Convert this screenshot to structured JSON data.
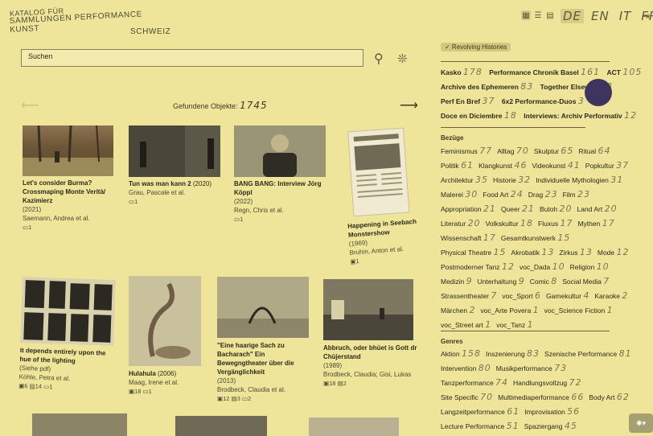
{
  "logo": {
    "line1": "KATALOG FÜR",
    "line2": "SAMMLUNGEN PERFORMANCE KUNST",
    "line3": "SCHWEIZ"
  },
  "view_icons": [
    "grid-view-icon",
    "list-view-icon",
    "table-view-icon"
  ],
  "languages": [
    {
      "label": "DE",
      "active": true
    },
    {
      "label": "EN"
    },
    {
      "label": "IT"
    },
    {
      "label": "FR"
    }
  ],
  "search": {
    "placeholder": "Suchen"
  },
  "results": {
    "label": "Gefundene Objekte:",
    "count": "1745"
  },
  "cards": [
    {
      "title": "Let's consider Burma? Crossmaping Monte Verità/ Kazimierz",
      "year": "(2021)",
      "author": "Saemann, Andrea et al.",
      "counts": "▭1"
    },
    {
      "title": "Tun was man kann 2",
      "year": "(2020)",
      "author": "Grau, Pascale et al.",
      "counts": "▭1"
    },
    {
      "title": "BANG BANG: Interview Jörg Köppl",
      "year": "(2022)",
      "author": "Regn, Chris et al.",
      "counts": "▭1"
    },
    {
      "title": "Happening in Seebach Monstershow",
      "year": "(1969)",
      "author": "Bruhin, Anton et al.",
      "counts": "▣1"
    },
    {
      "title": "It depends entirely upon the hue of the lighting",
      "year": "(Siehe pdf)",
      "author": "Köhle, Petra et al.",
      "counts": "▣6 ▤14 ▭1"
    },
    {
      "title": "Hulahula",
      "year": "(2006)",
      "author": "Maag, Irene et al.",
      "counts": "▣18 ▭1"
    },
    {
      "title": "\"Eine haarige Sach zu Bacharach\" Ein Bewegngtheater über die Vergänglichkeit",
      "year": "(2013)",
      "author": "Brodbeck, Claudia et al.",
      "counts": "▣12 ▤3 ▭2"
    },
    {
      "title": "Abbruch, oder bhüet is Gott dr Chüjerstand",
      "year": "(1989)",
      "author": "Brodbeck, Claudia; Gisi, Lukas",
      "counts": "▣18 ▤2"
    }
  ],
  "sidebar": {
    "badge": "✓ Revolving Histories",
    "collections": [
      {
        "label": "Kasko",
        "n": "178"
      },
      {
        "label": "Performance Chronik Basel",
        "n": "161"
      },
      {
        "label": "ACT",
        "n": "105"
      },
      {
        "label": "Archive des Ephemeren",
        "n": "83"
      },
      {
        "label": "Together Elsewhere",
        "n": "3"
      },
      {
        "label": "Perf En Bref",
        "n": "37"
      },
      {
        "label": "6x2 Performance-Duos",
        "n": "3"
      },
      {
        "label": "Doce en Diciembre",
        "n": "18"
      },
      {
        "label": "Interviews: Archiv Performativ",
        "n": "12"
      }
    ],
    "bezuege_title": "Bezüge",
    "bezuege": [
      {
        "label": "Feminismus",
        "n": "77"
      },
      {
        "label": "Alltag",
        "n": "70"
      },
      {
        "label": "Skulptur",
        "n": "65"
      },
      {
        "label": "Ritual",
        "n": "64"
      },
      {
        "label": "Politik",
        "n": "61"
      },
      {
        "label": "Klangkunst",
        "n": "46"
      },
      {
        "label": "Videokunst",
        "n": "41"
      },
      {
        "label": "Popkultur",
        "n": "37"
      },
      {
        "label": "Architektur",
        "n": "35"
      },
      {
        "label": "Historie",
        "n": "32"
      },
      {
        "label": "Individuelle Mythologien",
        "n": "31"
      },
      {
        "label": "Malerei",
        "n": "30"
      },
      {
        "label": "Food Art",
        "n": "24"
      },
      {
        "label": "Drag",
        "n": "23"
      },
      {
        "label": "Film",
        "n": "23"
      },
      {
        "label": "Appropriation",
        "n": "21"
      },
      {
        "label": "Queer",
        "n": "21"
      },
      {
        "label": "Butoh",
        "n": "20"
      },
      {
        "label": "Land Art",
        "n": "20"
      },
      {
        "label": "Literatur",
        "n": "20"
      },
      {
        "label": "Volkskultur",
        "n": "18"
      },
      {
        "label": "Fluxus",
        "n": "17"
      },
      {
        "label": "Mythen",
        "n": "17"
      },
      {
        "label": "Wissenschaft",
        "n": "17"
      },
      {
        "label": "Gesamtkunstwerk",
        "n": "15"
      },
      {
        "label": "Physical Theatre",
        "n": "15"
      },
      {
        "label": "Akrobatik",
        "n": "13"
      },
      {
        "label": "Zirkus",
        "n": "13"
      },
      {
        "label": "Mode",
        "n": "12"
      },
      {
        "label": "Postmoderner Tanz",
        "n": "12"
      },
      {
        "label": "voc_Dada",
        "n": "10"
      },
      {
        "label": "Religion",
        "n": "10"
      },
      {
        "label": "Medizin",
        "n": "9"
      },
      {
        "label": "Unterhaltung",
        "n": "9"
      },
      {
        "label": "Comic",
        "n": "8"
      },
      {
        "label": "Social Media",
        "n": "7"
      },
      {
        "label": "Strassentheater",
        "n": "7"
      },
      {
        "label": "voc_Sport",
        "n": "6"
      },
      {
        "label": "Gamekultur",
        "n": "4"
      },
      {
        "label": "Karaoke",
        "n": "2"
      },
      {
        "label": "Märchen",
        "n": "2"
      },
      {
        "label": "voc_Arte Povera",
        "n": "1"
      },
      {
        "label": "voc_Science Fiction",
        "n": "1"
      },
      {
        "label": "voc_Street art",
        "n": "1"
      },
      {
        "label": "voc_Tanz",
        "n": "1"
      }
    ],
    "genres_title": "Genres",
    "genres": [
      {
        "label": "Aktion",
        "n": "158"
      },
      {
        "label": "Inszenierung",
        "n": "83"
      },
      {
        "label": "Szenische Performance",
        "n": "81"
      },
      {
        "label": "Intervention",
        "n": "80"
      },
      {
        "label": "Musikperformance",
        "n": "73"
      },
      {
        "label": "Tanzperformance",
        "n": "74"
      },
      {
        "label": "Handlungsvollzug",
        "n": "72"
      },
      {
        "label": "Site Specific",
        "n": "70"
      },
      {
        "label": "Multimediaperformance",
        "n": "66"
      },
      {
        "label": "Body Art",
        "n": "62"
      },
      {
        "label": "Langzeitperformance",
        "n": "61"
      },
      {
        "label": "Improvisation",
        "n": "56"
      },
      {
        "label": "Lecture Performance",
        "n": "51"
      },
      {
        "label": "Spaziergang",
        "n": "45"
      }
    ]
  },
  "fab": "✱▾"
}
